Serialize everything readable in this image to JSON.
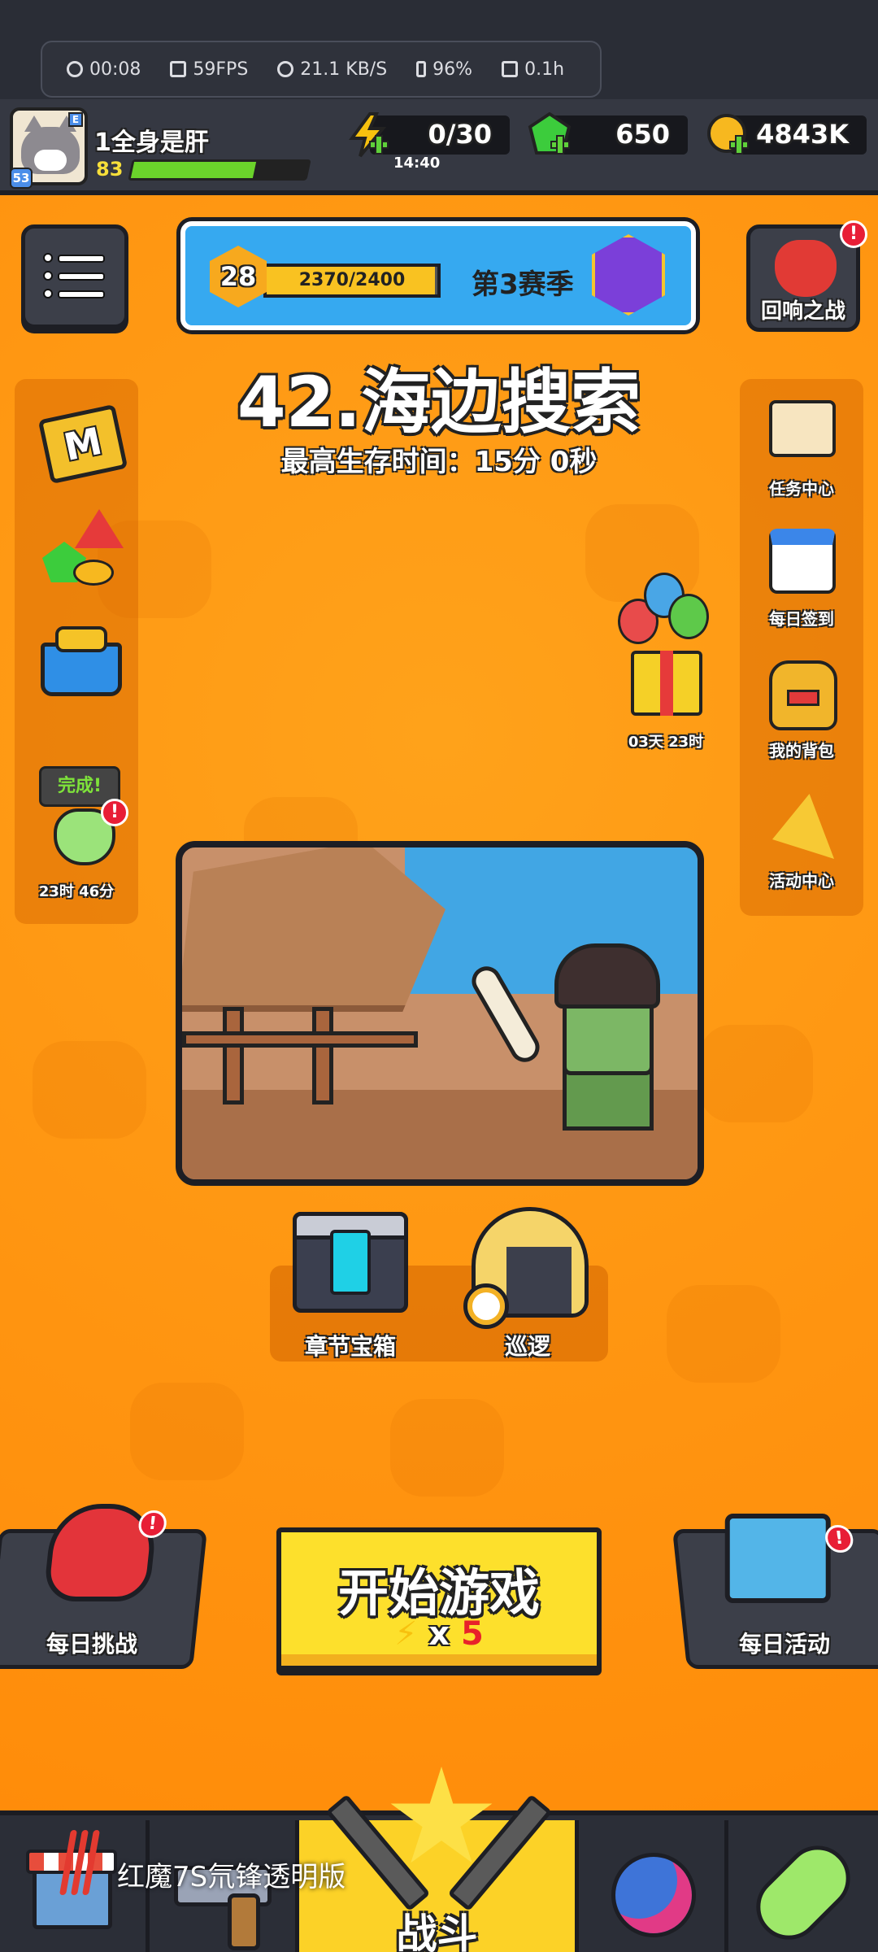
{
  "status_bar": {
    "time": "00:08",
    "fps": "59FPS",
    "network": "21.1 KB/S",
    "battery": "96%",
    "duration": "0.1h"
  },
  "player": {
    "name": "1全身是肝",
    "level": "83",
    "avatar_level": "53",
    "avatar_tag": "E",
    "xp_fraction": 0.7
  },
  "resources": {
    "energy": "0/30",
    "energy_timer": "14:40",
    "gems": "650",
    "coins": "4843K"
  },
  "season": {
    "level": "28",
    "xp": "2370/2400",
    "xp_fraction": 0.9875,
    "label": "第3赛季"
  },
  "echo_battle": {
    "label": "回响之战",
    "badge": "!"
  },
  "stage": {
    "title": "42.海边搜索",
    "best_time": "最高生存时间：15分 0秒"
  },
  "left_panel": {
    "completed_bubble": "完成!",
    "completed_timer": "23时 46分",
    "badge": "!"
  },
  "right_panel": {
    "task_center": "任务中心",
    "daily_checkin": "每日签到",
    "my_bag": "我的背包",
    "event_center": "活动中心"
  },
  "gift": {
    "timer": "03天 23时"
  },
  "mid_actions": {
    "chapter_chest": "章节宝箱",
    "patrol": "巡逻"
  },
  "bottom_actions": {
    "daily_challenge": "每日挑战",
    "start_game": "开始游戏",
    "start_cost_bolt": "⚡",
    "start_cost_x": "x",
    "start_cost_num": "5",
    "daily_event": "每日活动",
    "badge": "!"
  },
  "nav": {
    "battle": "战斗"
  },
  "overlay": {
    "device_text": "红魔7S氘锋透明版"
  },
  "colors": {
    "background": "#ff9410",
    "topbar": "#353842",
    "season_panel": "#36a9f0",
    "start_button": "#fde02c",
    "nav_active": "#fcd227",
    "alert_badge": "#e81e36"
  }
}
